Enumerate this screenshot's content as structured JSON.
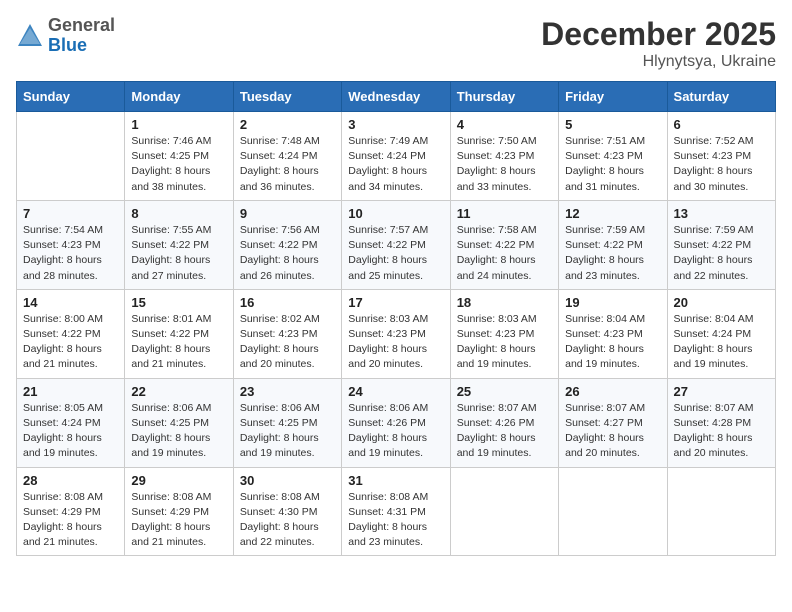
{
  "logo": {
    "general": "General",
    "blue": "Blue"
  },
  "header": {
    "title": "December 2025",
    "location": "Hlynytsya, Ukraine"
  },
  "weekdays": [
    "Sunday",
    "Monday",
    "Tuesday",
    "Wednesday",
    "Thursday",
    "Friday",
    "Saturday"
  ],
  "weeks": [
    [
      {
        "day": "",
        "info": ""
      },
      {
        "day": "1",
        "info": "Sunrise: 7:46 AM\nSunset: 4:25 PM\nDaylight: 8 hours\nand 38 minutes."
      },
      {
        "day": "2",
        "info": "Sunrise: 7:48 AM\nSunset: 4:24 PM\nDaylight: 8 hours\nand 36 minutes."
      },
      {
        "day": "3",
        "info": "Sunrise: 7:49 AM\nSunset: 4:24 PM\nDaylight: 8 hours\nand 34 minutes."
      },
      {
        "day": "4",
        "info": "Sunrise: 7:50 AM\nSunset: 4:23 PM\nDaylight: 8 hours\nand 33 minutes."
      },
      {
        "day": "5",
        "info": "Sunrise: 7:51 AM\nSunset: 4:23 PM\nDaylight: 8 hours\nand 31 minutes."
      },
      {
        "day": "6",
        "info": "Sunrise: 7:52 AM\nSunset: 4:23 PM\nDaylight: 8 hours\nand 30 minutes."
      }
    ],
    [
      {
        "day": "7",
        "info": "Sunrise: 7:54 AM\nSunset: 4:23 PM\nDaylight: 8 hours\nand 28 minutes."
      },
      {
        "day": "8",
        "info": "Sunrise: 7:55 AM\nSunset: 4:22 PM\nDaylight: 8 hours\nand 27 minutes."
      },
      {
        "day": "9",
        "info": "Sunrise: 7:56 AM\nSunset: 4:22 PM\nDaylight: 8 hours\nand 26 minutes."
      },
      {
        "day": "10",
        "info": "Sunrise: 7:57 AM\nSunset: 4:22 PM\nDaylight: 8 hours\nand 25 minutes."
      },
      {
        "day": "11",
        "info": "Sunrise: 7:58 AM\nSunset: 4:22 PM\nDaylight: 8 hours\nand 24 minutes."
      },
      {
        "day": "12",
        "info": "Sunrise: 7:59 AM\nSunset: 4:22 PM\nDaylight: 8 hours\nand 23 minutes."
      },
      {
        "day": "13",
        "info": "Sunrise: 7:59 AM\nSunset: 4:22 PM\nDaylight: 8 hours\nand 22 minutes."
      }
    ],
    [
      {
        "day": "14",
        "info": "Sunrise: 8:00 AM\nSunset: 4:22 PM\nDaylight: 8 hours\nand 21 minutes."
      },
      {
        "day": "15",
        "info": "Sunrise: 8:01 AM\nSunset: 4:22 PM\nDaylight: 8 hours\nand 21 minutes."
      },
      {
        "day": "16",
        "info": "Sunrise: 8:02 AM\nSunset: 4:23 PM\nDaylight: 8 hours\nand 20 minutes."
      },
      {
        "day": "17",
        "info": "Sunrise: 8:03 AM\nSunset: 4:23 PM\nDaylight: 8 hours\nand 20 minutes."
      },
      {
        "day": "18",
        "info": "Sunrise: 8:03 AM\nSunset: 4:23 PM\nDaylight: 8 hours\nand 19 minutes."
      },
      {
        "day": "19",
        "info": "Sunrise: 8:04 AM\nSunset: 4:23 PM\nDaylight: 8 hours\nand 19 minutes."
      },
      {
        "day": "20",
        "info": "Sunrise: 8:04 AM\nSunset: 4:24 PM\nDaylight: 8 hours\nand 19 minutes."
      }
    ],
    [
      {
        "day": "21",
        "info": "Sunrise: 8:05 AM\nSunset: 4:24 PM\nDaylight: 8 hours\nand 19 minutes."
      },
      {
        "day": "22",
        "info": "Sunrise: 8:06 AM\nSunset: 4:25 PM\nDaylight: 8 hours\nand 19 minutes."
      },
      {
        "day": "23",
        "info": "Sunrise: 8:06 AM\nSunset: 4:25 PM\nDaylight: 8 hours\nand 19 minutes."
      },
      {
        "day": "24",
        "info": "Sunrise: 8:06 AM\nSunset: 4:26 PM\nDaylight: 8 hours\nand 19 minutes."
      },
      {
        "day": "25",
        "info": "Sunrise: 8:07 AM\nSunset: 4:26 PM\nDaylight: 8 hours\nand 19 minutes."
      },
      {
        "day": "26",
        "info": "Sunrise: 8:07 AM\nSunset: 4:27 PM\nDaylight: 8 hours\nand 20 minutes."
      },
      {
        "day": "27",
        "info": "Sunrise: 8:07 AM\nSunset: 4:28 PM\nDaylight: 8 hours\nand 20 minutes."
      }
    ],
    [
      {
        "day": "28",
        "info": "Sunrise: 8:08 AM\nSunset: 4:29 PM\nDaylight: 8 hours\nand 21 minutes."
      },
      {
        "day": "29",
        "info": "Sunrise: 8:08 AM\nSunset: 4:29 PM\nDaylight: 8 hours\nand 21 minutes."
      },
      {
        "day": "30",
        "info": "Sunrise: 8:08 AM\nSunset: 4:30 PM\nDaylight: 8 hours\nand 22 minutes."
      },
      {
        "day": "31",
        "info": "Sunrise: 8:08 AM\nSunset: 4:31 PM\nDaylight: 8 hours\nand 23 minutes."
      },
      {
        "day": "",
        "info": ""
      },
      {
        "day": "",
        "info": ""
      },
      {
        "day": "",
        "info": ""
      }
    ]
  ]
}
